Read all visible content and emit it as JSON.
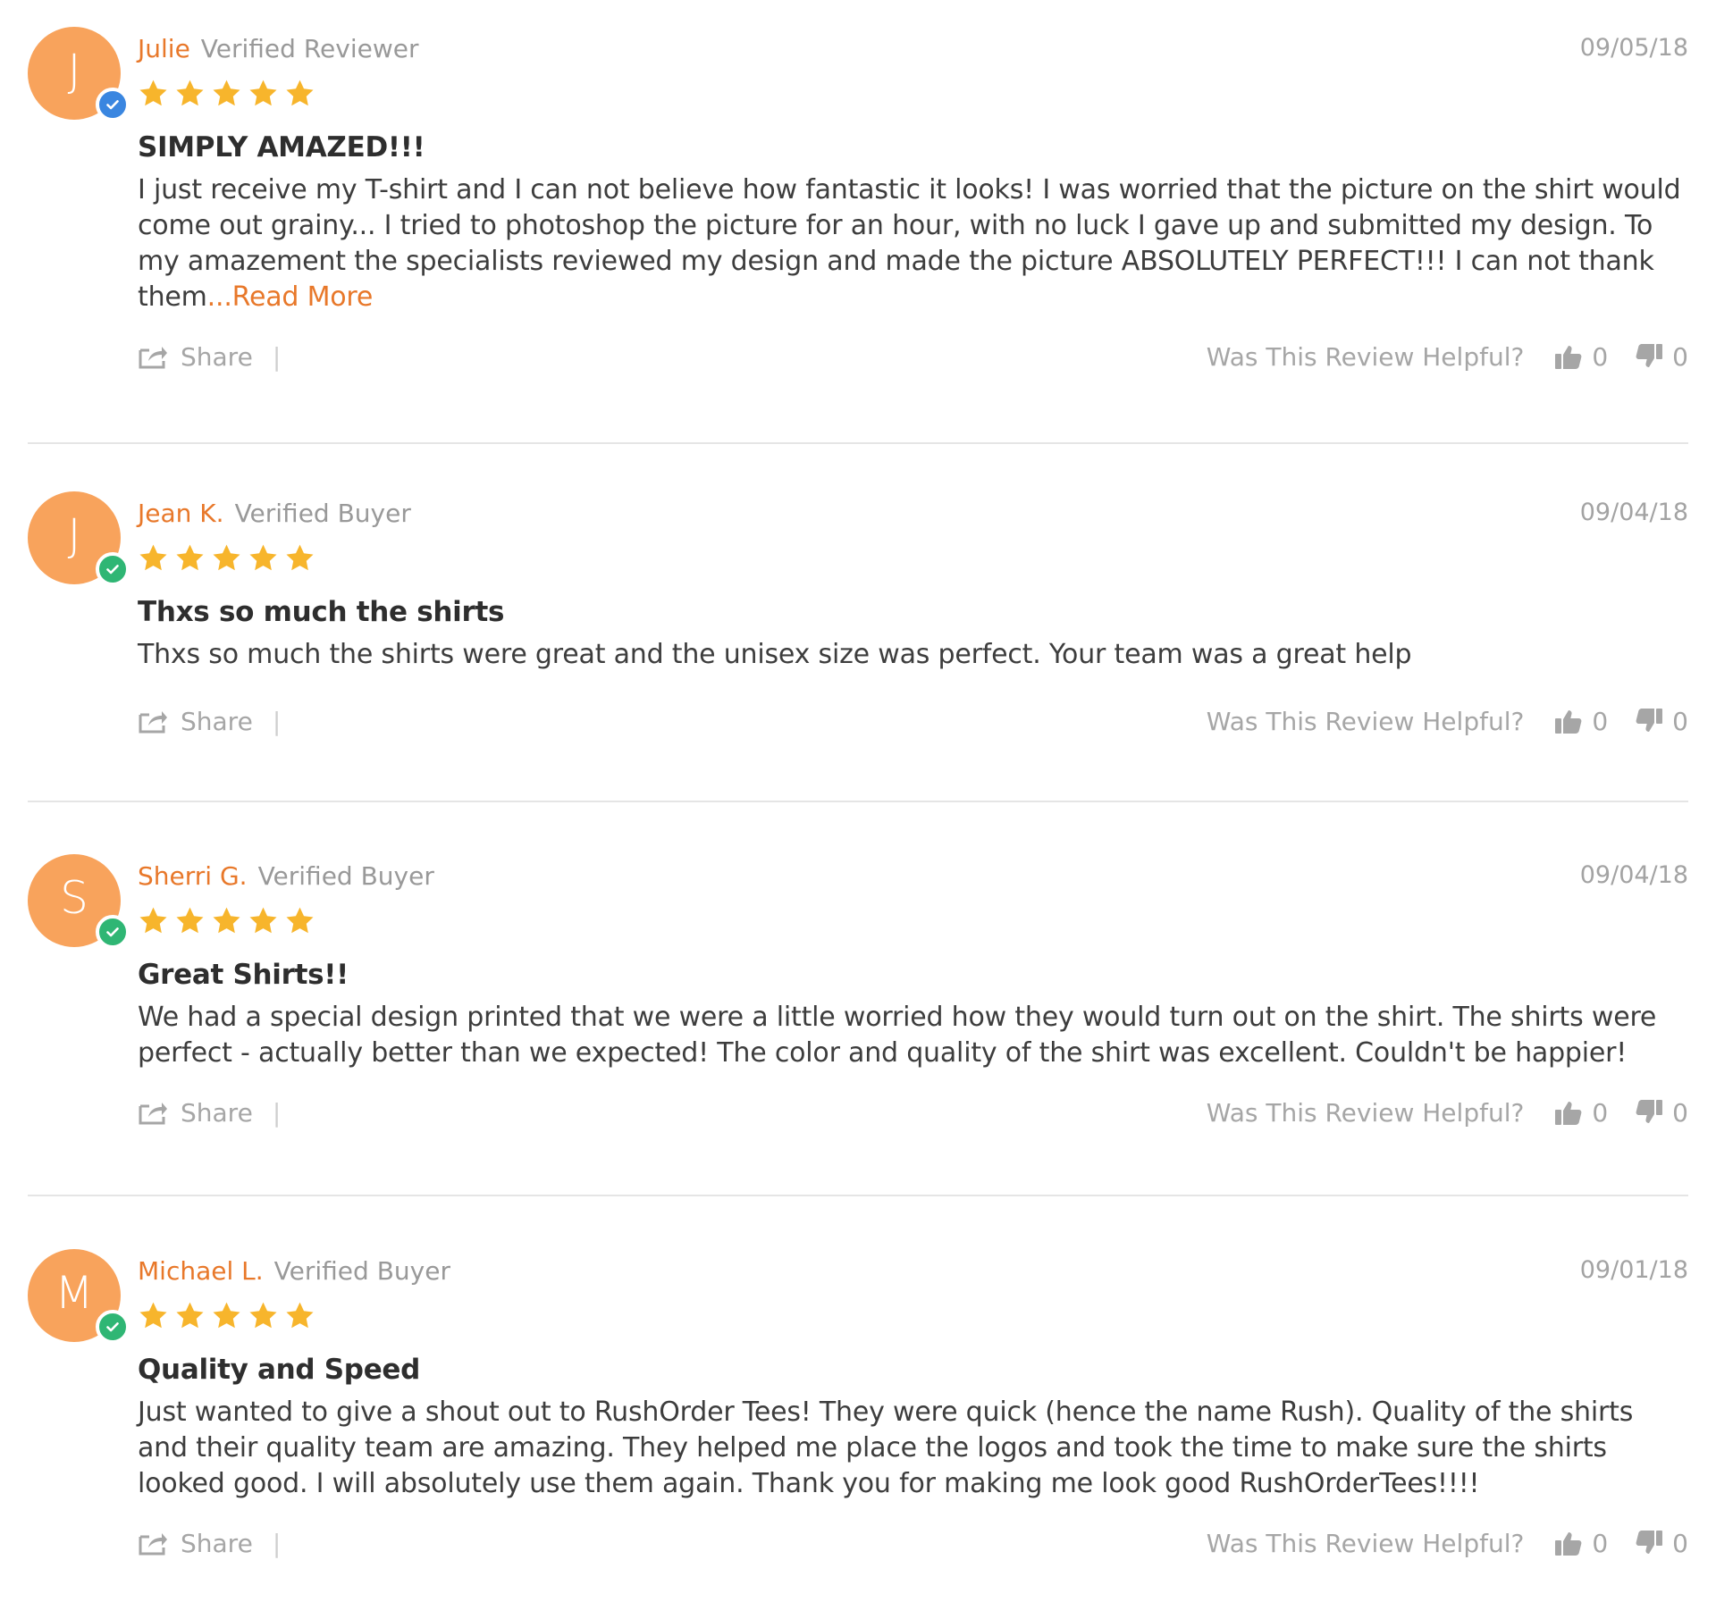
{
  "colors": {
    "avatar": "#f8a35c",
    "name": "#e8782a",
    "star": "#f7b52c",
    "verified_blue": "#3a86e0",
    "verified_green": "#2fb674"
  },
  "icons": {
    "star": "star-icon",
    "verified": "checkmark-icon",
    "share": "share-icon",
    "thumbs_up": "thumbs-up-icon",
    "thumbs_down": "thumbs-down-icon"
  },
  "labels": {
    "share": "Share",
    "separator": "|",
    "helpful": "Was This Review Helpful?"
  },
  "reviews": [
    {
      "initial": "J",
      "name": "Julie",
      "role": "Verified Reviewer",
      "badge": "blue",
      "date": "09/05/18",
      "rating": 5,
      "title": "SIMPLY AMAZED!!!",
      "body": "I just receive my T-shirt and I can not believe how fantastic it looks! I was worried that the picture on the shirt would come out grainy... I tried to photoshop the picture for an hour, with no luck I gave up and submitted my design. To my amazement the specialists reviewed my design and made the picture ABSOLUTELY PERFECT!!! I can not thank them",
      "read_more": "...Read More",
      "up_count": "0",
      "down_count": "0"
    },
    {
      "initial": "J",
      "name": "Jean K.",
      "role": "Verified Buyer",
      "badge": "green",
      "date": "09/04/18",
      "rating": 5,
      "title": "Thxs so much the shirts",
      "body": "Thxs so much the shirts were great and the unisex size was perfect. Your team was a great help",
      "read_more": "",
      "up_count": "0",
      "down_count": "0"
    },
    {
      "initial": "S",
      "name": "Sherri G.",
      "role": "Verified Buyer",
      "badge": "green",
      "date": "09/04/18",
      "rating": 5,
      "title": "Great Shirts!!",
      "body": "We had a special design printed that we were a little worried how they would turn out on the shirt. The shirts were perfect - actually better than we expected! The color and quality of the shirt was excellent. Couldn't be happier!",
      "read_more": "",
      "up_count": "0",
      "down_count": "0"
    },
    {
      "initial": "M",
      "name": "Michael L.",
      "role": "Verified Buyer",
      "badge": "green",
      "date": "09/01/18",
      "rating": 5,
      "title": "Quality and Speed",
      "body": "Just wanted to give a shout out to RushOrder Tees! They were quick (hence the name Rush). Quality of the shirts and their quality team are amazing. They helped me place the logos and took the time to make sure the shirts looked good. I will absolutely use them again. Thank you for making me look good RushOrderTees!!!!",
      "read_more": "",
      "up_count": "0",
      "down_count": "0"
    }
  ]
}
